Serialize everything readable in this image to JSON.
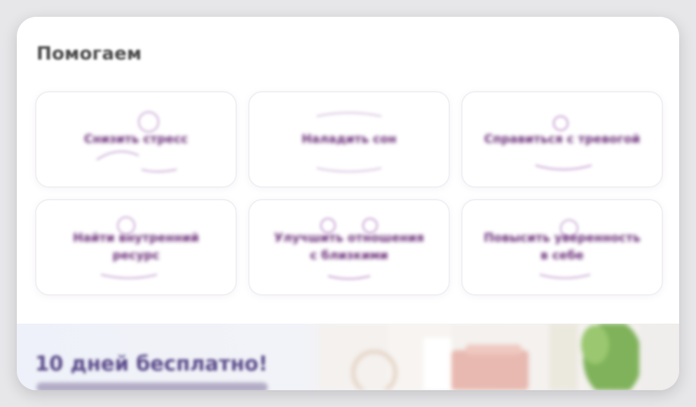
{
  "section": {
    "title": "Помогаем"
  },
  "tiles": [
    {
      "label": "Снизить стресс"
    },
    {
      "label": "Наладить сон"
    },
    {
      "label": "Справиться с тревогой"
    },
    {
      "label": "Найти внутренний ресурс"
    },
    {
      "label": "Улучшить отношения с близкими"
    },
    {
      "label": "Повысить уверенность в себе"
    }
  ],
  "promo": {
    "title": "10 дней бесплатно!"
  },
  "colors": {
    "page_background": "#e7e7ea",
    "card": "#ffffff",
    "tile_text": "#6a2d78",
    "tile_accent": "#b98bc7",
    "promo_title": "#5a4a8a"
  }
}
